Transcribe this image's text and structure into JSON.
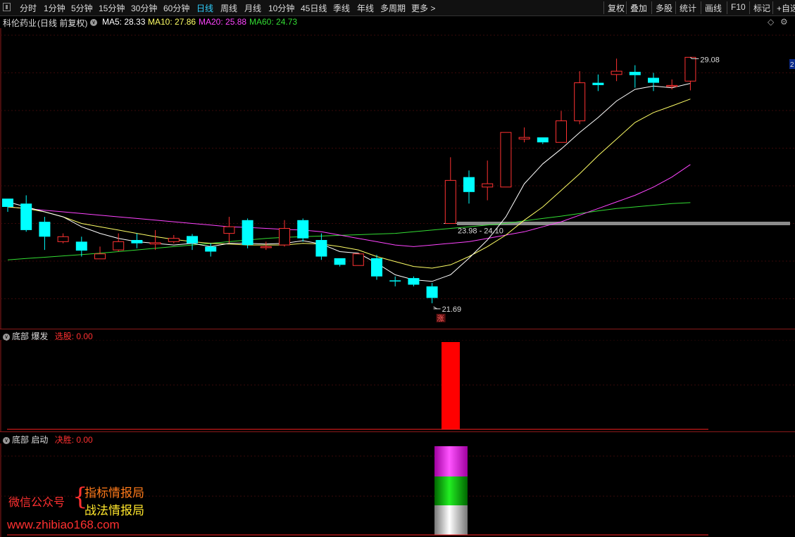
{
  "toolbar": {
    "period_tabs": [
      "分时",
      "1分钟",
      "5分钟",
      "15分钟",
      "30分钟",
      "60分钟",
      "日线",
      "周线",
      "月线",
      "10分钟",
      "45日线",
      "季线",
      "年线",
      "多周期",
      "更多 >"
    ],
    "active_tab": "日线",
    "right_buttons": [
      "复权",
      "叠加",
      "多股",
      "统计",
      "画线",
      "F10",
      "标记",
      "+自选"
    ]
  },
  "stock": {
    "name": "科伦药业",
    "mode": "(日线 前复权)",
    "ma": [
      {
        "label": "MA5: 28.33",
        "color": "#ffffff"
      },
      {
        "label": "MA10: 27.86",
        "color": "#ffff66"
      },
      {
        "label": "MA20: 25.88",
        "color": "#ff44ff"
      },
      {
        "label": "MA60: 24.73",
        "color": "#33dd33"
      }
    ]
  },
  "main_chart": {
    "high_label": "29.08",
    "low_label": "21.69",
    "range_label": "23.98 - 24.10",
    "rise_tag": "涨",
    "right_edge_label": "2",
    "colors": {
      "up": "#ff3232",
      "down": "#00ffff",
      "ma5": "#ffffff",
      "ma10": "#ffff66",
      "ma20": "#ff44ff",
      "ma60": "#33dd33",
      "level": "#8c8c8c"
    }
  },
  "chart_data": {
    "type": "candlestick",
    "ylim": [
      20.9,
      30.0
    ],
    "candles": [
      {
        "o": 24.85,
        "c": 24.6,
        "h": 24.85,
        "l": 24.45
      },
      {
        "o": 24.7,
        "c": 23.9,
        "h": 24.95,
        "l": 23.85
      },
      {
        "o": 24.15,
        "c": 23.7,
        "h": 24.3,
        "l": 23.3
      },
      {
        "o": 23.55,
        "c": 23.7,
        "h": 23.8,
        "l": 23.5
      },
      {
        "o": 23.55,
        "c": 23.28,
        "h": 23.7,
        "l": 23.1
      },
      {
        "o": 23.03,
        "c": 23.18,
        "h": 23.4,
        "l": 23.05
      },
      {
        "o": 23.3,
        "c": 23.55,
        "h": 23.8,
        "l": 23.25
      },
      {
        "o": 23.6,
        "c": 23.5,
        "h": 23.8,
        "l": 23.35
      },
      {
        "o": 23.48,
        "c": 23.52,
        "h": 23.9,
        "l": 23.3
      },
      {
        "o": 23.55,
        "c": 23.65,
        "h": 23.75,
        "l": 23.5
      },
      {
        "o": 23.72,
        "c": 23.5,
        "h": 23.78,
        "l": 23.3
      },
      {
        "o": 23.4,
        "c": 23.25,
        "h": 23.5,
        "l": 23.1
      },
      {
        "o": 23.8,
        "c": 24.0,
        "h": 24.3,
        "l": 23.5
      },
      {
        "o": 24.2,
        "c": 23.45,
        "h": 24.25,
        "l": 23.35
      },
      {
        "o": 23.38,
        "c": 23.4,
        "h": 23.55,
        "l": 23.3
      },
      {
        "o": 23.45,
        "c": 23.95,
        "h": 24.2,
        "l": 23.4
      },
      {
        "o": 24.2,
        "c": 23.65,
        "h": 24.25,
        "l": 23.55
      },
      {
        "o": 23.6,
        "c": 23.1,
        "h": 23.8,
        "l": 23.0
      },
      {
        "o": 23.05,
        "c": 22.85,
        "h": 23.05,
        "l": 22.8
      },
      {
        "o": 22.83,
        "c": 23.18,
        "h": 23.18,
        "l": 22.83
      },
      {
        "o": 23.05,
        "c": 22.5,
        "h": 23.15,
        "l": 22.4
      },
      {
        "o": 22.38,
        "c": 22.35,
        "h": 22.5,
        "l": 22.2
      },
      {
        "o": 22.45,
        "c": 22.25,
        "h": 22.5,
        "l": 22.2
      },
      {
        "o": 22.2,
        "c": 21.85,
        "h": 22.3,
        "l": 21.69
      },
      {
        "o": 24.1,
        "c": 25.4,
        "h": 26.1,
        "l": 24.1
      },
      {
        "o": 25.5,
        "c": 25.05,
        "h": 25.7,
        "l": 24.7
      },
      {
        "o": 25.2,
        "c": 25.3,
        "h": 26.0,
        "l": 24.8
      },
      {
        "o": 25.2,
        "c": 26.85,
        "h": 26.85,
        "l": 25.2
      },
      {
        "o": 26.65,
        "c": 26.7,
        "h": 27.0,
        "l": 26.55
      },
      {
        "o": 26.7,
        "c": 26.55,
        "h": 26.7,
        "l": 26.5
      },
      {
        "o": 26.55,
        "c": 27.2,
        "h": 27.5,
        "l": 26.55
      },
      {
        "o": 27.2,
        "c": 28.35,
        "h": 28.7,
        "l": 27.1
      },
      {
        "o": 28.35,
        "c": 28.28,
        "h": 28.6,
        "l": 28.1
      },
      {
        "o": 28.6,
        "c": 28.7,
        "h": 29.08,
        "l": 28.4
      },
      {
        "o": 28.68,
        "c": 28.58,
        "h": 28.88,
        "l": 28.2
      },
      {
        "o": 28.5,
        "c": 28.35,
        "h": 28.65,
        "l": 28.1
      },
      {
        "o": 28.27,
        "c": 28.27,
        "h": 28.45,
        "l": 28.15
      },
      {
        "o": 28.4,
        "c": 29.12,
        "h": 29.12,
        "l": 28.12
      }
    ],
    "ma5": [
      24.75,
      24.6,
      24.45,
      24.3,
      24.0,
      23.8,
      23.65,
      23.55,
      23.5,
      23.45,
      23.5,
      23.4,
      23.5,
      23.5,
      23.48,
      23.5,
      23.58,
      23.48,
      23.25,
      23.2,
      22.9,
      22.55,
      22.4,
      22.35,
      22.55,
      23.05,
      23.6,
      24.3,
      25.3,
      25.9,
      26.35,
      26.85,
      27.3,
      27.8,
      28.15,
      28.25,
      28.2,
      28.33
    ],
    "ma10": [
      24.6,
      24.55,
      24.45,
      24.3,
      24.1,
      24.0,
      23.9,
      23.8,
      23.7,
      23.62,
      23.55,
      23.5,
      23.48,
      23.45,
      23.45,
      23.45,
      23.5,
      23.48,
      23.4,
      23.3,
      23.1,
      22.95,
      22.8,
      22.75,
      22.85,
      23.1,
      23.4,
      23.75,
      24.2,
      24.6,
      25.1,
      25.6,
      26.15,
      26.65,
      27.15,
      27.45,
      27.65,
      27.86
    ],
    "ma20": [
      24.6,
      24.55,
      24.5,
      24.45,
      24.4,
      24.35,
      24.3,
      24.25,
      24.2,
      24.15,
      24.1,
      24.05,
      24.0,
      23.98,
      23.95,
      23.92,
      23.9,
      23.85,
      23.75,
      23.65,
      23.55,
      23.45,
      23.4,
      23.45,
      23.5,
      23.55,
      23.65,
      23.75,
      23.85,
      24.0,
      24.15,
      24.35,
      24.55,
      24.75,
      24.95,
      25.2,
      25.5,
      25.88
    ],
    "ma60": [
      23.0,
      23.04,
      23.08,
      23.12,
      23.16,
      23.2,
      23.25,
      23.3,
      23.35,
      23.4,
      23.45,
      23.5,
      23.55,
      23.6,
      23.65,
      23.68,
      23.7,
      23.72,
      23.74,
      23.76,
      23.78,
      23.8,
      23.85,
      23.9,
      23.95,
      24.0,
      24.05,
      24.1,
      24.18,
      24.25,
      24.32,
      24.4,
      24.48,
      24.55,
      24.6,
      24.65,
      24.7,
      24.73
    ],
    "level_line": 24.1
  },
  "panel1": {
    "name": "底部 爆发",
    "sig_label": "选股: 0.00"
  },
  "panel2": {
    "name": "底部 启动",
    "sig_label": "决胜: 0.00"
  },
  "watermark": {
    "account": "微信公众号",
    "brace": "{",
    "line1": "指标情报局",
    "line2": "战法情报局",
    "url": "www.zhibiao168.com"
  }
}
